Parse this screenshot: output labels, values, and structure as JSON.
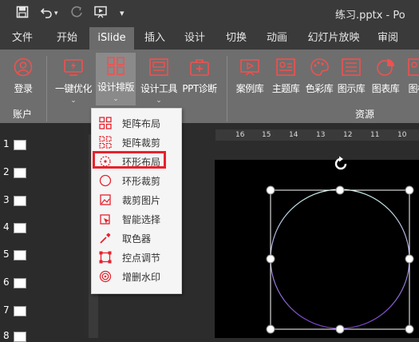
{
  "window": {
    "doc_title": "练习.pptx - Po"
  },
  "quick_access": [
    "save-icon",
    "undo-icon",
    "redo-icon",
    "slideshow-icon",
    "customize-dropdown-icon"
  ],
  "tabs": [
    {
      "label": "文件"
    },
    {
      "label": "开始"
    },
    {
      "label": "iSlide"
    },
    {
      "label": "插入"
    },
    {
      "label": "设计"
    },
    {
      "label": "切换"
    },
    {
      "label": "动画"
    },
    {
      "label": "幻灯片放映"
    },
    {
      "label": "审阅"
    }
  ],
  "active_tab": "iSlide",
  "ribbon": {
    "buttons": [
      {
        "label": "登录",
        "icon": "user-icon"
      },
      {
        "label": "一键优化",
        "icon": "optimize-icon"
      },
      {
        "label": "设计排版",
        "icon": "layout-icon"
      },
      {
        "label": "设计工具",
        "icon": "design-tools-icon"
      },
      {
        "label": "PPT诊断",
        "icon": "diagnose-icon"
      },
      {
        "label": "案例库",
        "icon": "case-library-icon"
      },
      {
        "label": "主题库",
        "icon": "theme-library-icon"
      },
      {
        "label": "色彩库",
        "icon": "palette-icon"
      },
      {
        "label": "图示库",
        "icon": "diagram-library-icon"
      },
      {
        "label": "图表库",
        "icon": "chart-library-icon"
      },
      {
        "label": "图标",
        "icon": "icon-library-icon"
      }
    ],
    "groups": [
      {
        "label": "账户"
      },
      {
        "label": "资源"
      }
    ]
  },
  "ruler_ticks": [
    "16",
    "15",
    "14",
    "13",
    "12",
    "11",
    "10"
  ],
  "thumbnails": [
    "1",
    "2",
    "3",
    "4",
    "5",
    "6",
    "7",
    "8"
  ],
  "menu": {
    "items": [
      {
        "label": "矩阵布局",
        "icon": "matrix-layout-icon"
      },
      {
        "label": "矩阵裁剪",
        "icon": "matrix-crop-icon"
      },
      {
        "label": "环形布局",
        "icon": "ring-layout-icon"
      },
      {
        "label": "环形裁剪",
        "icon": "ring-crop-icon"
      },
      {
        "label": "裁剪图片",
        "icon": "crop-image-icon"
      },
      {
        "label": "智能选择",
        "icon": "smart-select-icon"
      },
      {
        "label": "取色器",
        "icon": "eyedropper-icon"
      },
      {
        "label": "控点调节",
        "icon": "handle-adjust-icon"
      },
      {
        "label": "增删水印",
        "icon": "watermark-icon"
      }
    ],
    "highlighted_index": 2
  },
  "colors": {
    "accent": "#e8212b",
    "titlebar": "#3a3a3a",
    "ribbon": "#6e6e6e"
  }
}
